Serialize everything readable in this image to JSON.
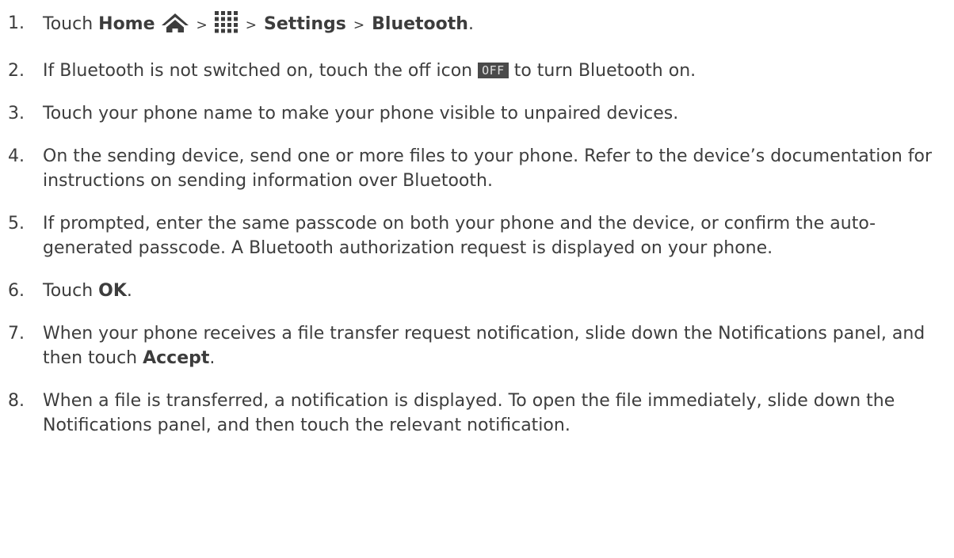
{
  "steps": [
    {
      "num": "1.",
      "touch": "Touch",
      "home": "Home",
      "sep1": ">",
      "sep2": ">",
      "settings": "Settings",
      "sep3": ">",
      "bluetooth": "Bluetooth",
      "end": ".",
      "home_icon": "home-icon",
      "apps_icon": "apps-grid-icon"
    },
    {
      "num": "2.",
      "text_a": "If Bluetooth is not switched on, touch the off icon",
      "off_label": "OFF",
      "text_b": "to turn Bluetooth on."
    },
    {
      "num": "3.",
      "text": "Touch your phone name to make your phone visible to unpaired devices."
    },
    {
      "num": "4.",
      "text": "On the sending device, send one or more files to your phone. Refer to the device’s documentation for instructions on sending information over Bluetooth."
    },
    {
      "num": "5.",
      "text": "If prompted, enter the same passcode on both your phone and the device, or confirm the auto-generated passcode. A Bluetooth authorization request is displayed on your phone."
    },
    {
      "num": "6.",
      "touch": "Touch",
      "ok": "OK",
      "end": "."
    },
    {
      "num": "7.",
      "text": "When your phone receives a file transfer request notification, slide down the Notifications panel, and then touch",
      "accept": "Accept",
      "end": "."
    },
    {
      "num": "8.",
      "text": "When a file is transferred, a notification is displayed. To open the file immediately, slide down the Notifications panel, and then touch the relevant notification."
    }
  ],
  "colors": {
    "text": "#3d3d3d",
    "off_icon_bg": "#4a4a4a",
    "off_icon_text": "#e0e0e0",
    "icon_dark": "#3d3d3d"
  }
}
